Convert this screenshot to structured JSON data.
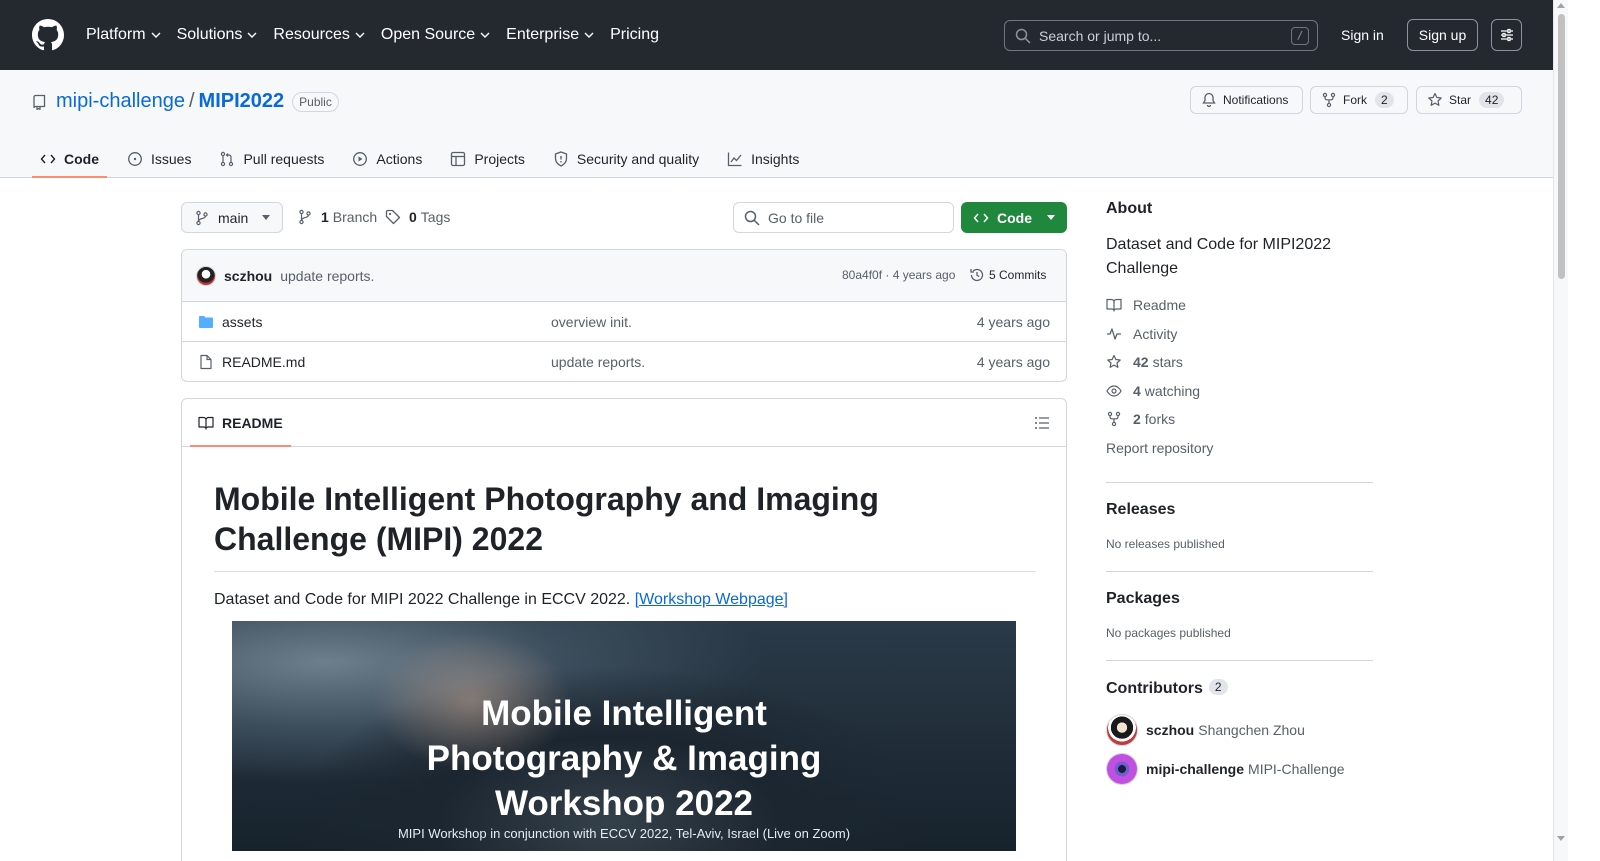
{
  "header": {
    "nav": [
      "Platform",
      "Solutions",
      "Resources",
      "Open Source",
      "Enterprise",
      "Pricing"
    ],
    "search_placeholder": "Search or jump to...",
    "search_shortcut": "/",
    "sign_in": "Sign in",
    "sign_up": "Sign up"
  },
  "repo": {
    "owner": "mipi-challenge",
    "separator": "/",
    "name": "MIPI2022",
    "visibility": "Public",
    "notifications_label": "Notifications",
    "fork_label": "Fork",
    "fork_count": "2",
    "star_label": "Star",
    "star_count": "42"
  },
  "tabs": [
    "Code",
    "Issues",
    "Pull requests",
    "Actions",
    "Projects",
    "Security and quality",
    "Insights"
  ],
  "toolbar": {
    "branch": "main",
    "branch_count": "1",
    "branch_label": "Branch",
    "tag_count": "0",
    "tag_label": "Tags",
    "goto_placeholder": "Go to file",
    "code_label": "Code"
  },
  "commit": {
    "author": "sczhou",
    "message": "update reports.",
    "sha_time": "80a4f0f · 4 years ago",
    "commits_label": "5 Commits"
  },
  "files": [
    {
      "name": "assets",
      "type": "folder",
      "message": "overview init.",
      "age": "4 years ago"
    },
    {
      "name": "README.md",
      "type": "file",
      "message": "update reports.",
      "age": "4 years ago"
    }
  ],
  "readme": {
    "tab_label": "README",
    "heading": "Mobile Intelligent Photography and Imaging Challenge (MIPI) 2022",
    "intro": "Dataset and Code for MIPI 2022 Challenge in ECCV 2022.",
    "link_text": "[Workshop Webpage]",
    "banner_title_1": "Mobile Intelligent",
    "banner_title_2": "Photography & Imaging",
    "banner_title_3": "Workshop 2022",
    "banner_subtitle": "MIPI Workshop in conjunction with ECCV 2022, Tel-Aviv, Israel (Live on Zoom)"
  },
  "sidebar": {
    "about_title": "About",
    "description": "Dataset and Code for MIPI2022 Challenge",
    "readme": "Readme",
    "activity": "Activity",
    "stars_count": "42",
    "stars_label": "stars",
    "watching_count": "4",
    "watching_label": "watching",
    "forks_count": "2",
    "forks_label": "forks",
    "report": "Report repository",
    "releases_title": "Releases",
    "releases_text": "No releases published",
    "packages_title": "Packages",
    "packages_text": "No packages published",
    "contributors_title": "Contributors",
    "contributors_count": "2",
    "contributors": [
      {
        "login": "sczhou",
        "name": "Shangchen Zhou"
      },
      {
        "login": "mipi-challenge",
        "name": "MIPI-Challenge"
      }
    ]
  },
  "colors": {
    "header_bg": "#24292f",
    "link": "#0969da",
    "primary_button": "#1f883d",
    "active_tab_underline": "#fd8c73"
  }
}
